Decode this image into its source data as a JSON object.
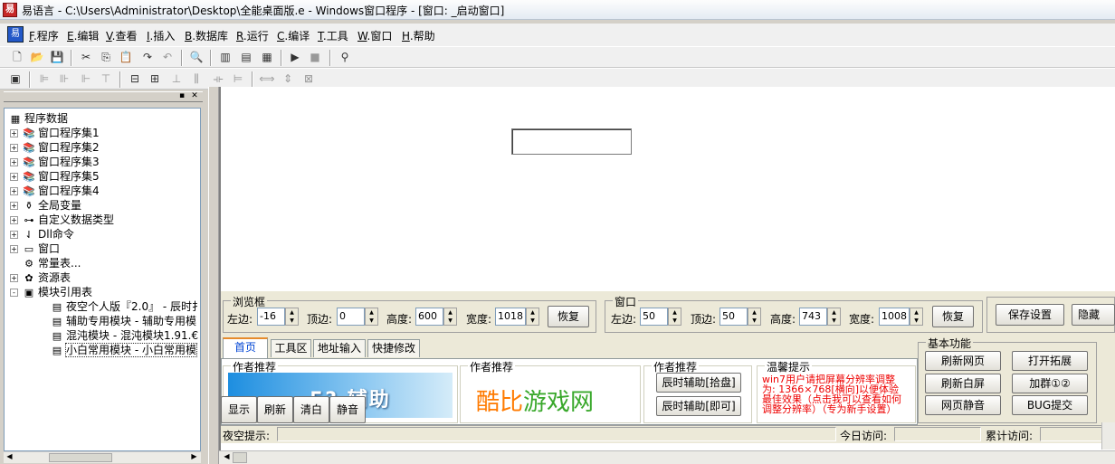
{
  "window": {
    "app_icon": "易",
    "title": "易语言 - C:\\Users\\Administrator\\Desktop\\全能桌面版.e - Windows窗口程序 - [窗口: _启动窗口]"
  },
  "menu": [
    {
      "key": "F",
      "label": ".程序"
    },
    {
      "key": "E",
      "label": ".编辑"
    },
    {
      "key": "V",
      "label": ".查看"
    },
    {
      "key": "I",
      "label": ".插入"
    },
    {
      "key": "B",
      "label": ".数据库"
    },
    {
      "key": "R",
      "label": ".运行"
    },
    {
      "key": "C",
      "label": ".编译"
    },
    {
      "key": "T",
      "label": ".工具"
    },
    {
      "key": "W",
      "label": ".窗口"
    },
    {
      "key": "H",
      "label": ".帮助"
    }
  ],
  "toolbar1_icons": [
    "new-file-icon",
    "open-folder-icon",
    "save-icon",
    "cut-icon",
    "copy-icon",
    "paste-icon",
    "redo-icon",
    "undo-icon",
    "find-icon",
    "layout1-icon",
    "layout2-icon",
    "layout3-icon",
    "run-icon",
    "stop-icon",
    "binoculars-icon"
  ],
  "toolbar2_icons": [
    "grid-icon",
    "align-left-icon",
    "align-center-icon",
    "align-right-icon",
    "align-top-icon",
    "align-middle-icon",
    "align-bottom-icon",
    "space-h-icon",
    "space-v-icon",
    "same-width-icon",
    "same-height-icon",
    "same-size-icon"
  ],
  "tree": {
    "root": "程序数据",
    "items": [
      {
        "label": "窗口程序集1",
        "pm": "+",
        "icon": "books-icon"
      },
      {
        "label": "窗口程序集2",
        "pm": "+",
        "icon": "books-icon"
      },
      {
        "label": "窗口程序集3",
        "pm": "+",
        "icon": "books-icon"
      },
      {
        "label": "窗口程序集5",
        "pm": "+",
        "icon": "books-icon"
      },
      {
        "label": "窗口程序集4",
        "pm": "+",
        "icon": "books-icon"
      },
      {
        "label": "全局变量",
        "pm": "+",
        "icon": "jar-icon"
      },
      {
        "label": "自定义数据类型",
        "pm": "+",
        "icon": "type-icon"
      },
      {
        "label": "Dll命令",
        "pm": "+",
        "icon": "dll-icon"
      },
      {
        "label": "窗口",
        "pm": "+",
        "icon": "window-icon"
      },
      {
        "label": "常量表...",
        "pm": "",
        "icon": "const-icon"
      },
      {
        "label": "资源表",
        "pm": "+",
        "icon": "resource-icon"
      },
      {
        "label": "模块引用表",
        "pm": "-",
        "icon": "module-icon"
      }
    ],
    "modules": [
      "夜空个人版『2.0』 - 辰时扌",
      "辅助专用模块 - 辅助专用模",
      "混沌模块 - 混沌模块1.91.€",
      "小白常用模块 - 小白常用模"
    ]
  },
  "browser_group": {
    "title": "浏览框",
    "left_label": "左边:",
    "left_value": "-16",
    "top_label": "顶边:",
    "top_value": "0",
    "height_label": "高度:",
    "height_value": "600",
    "width_label": "宽度:",
    "width_value": "1018",
    "restore": "恢复"
  },
  "window_group": {
    "title": "窗口",
    "left_label": "左边:",
    "left_value": "50",
    "top_label": "顶边:",
    "top_value": "50",
    "height_label": "高度:",
    "height_value": "743",
    "width_label": "宽度:",
    "width_value": "1008",
    "restore": "恢复"
  },
  "save_settings": "保存设置",
  "hide_label": "隐藏",
  "tabs": [
    "首页",
    "工具区",
    "地址输入",
    "快捷修改"
  ],
  "recommend1": {
    "title": "作者推荐",
    "banner_text": "5?   辅助"
  },
  "recommend2": {
    "title": "作者推荐",
    "kubi_a": "酷比",
    "kubi_b": "游戏网"
  },
  "recommend3": {
    "title": "作者推荐",
    "btn1": "辰时辅助[拾盘]",
    "btn2": "辰时辅助[即可]"
  },
  "warm_tip": {
    "title": "温馨提示",
    "lines": [
      "win7用户请把屏幕分辨率调整",
      "为: 1366×768[横向]以便体验",
      "最佳效果（点击我可以查看如何",
      "调整分辨率）（专为新手设置）"
    ]
  },
  "basic": {
    "title": "基本功能",
    "btn_refresh_web": "刷新网页",
    "btn_open_ext": "打开拓展",
    "btn_refresh_white": "刷新白屏",
    "btn_join": "加群①②",
    "btn_mute": "网页静音",
    "btn_bug": "BUG提交"
  },
  "bottom_btns": [
    "显示",
    "刷新",
    "清白",
    "静音"
  ],
  "status": {
    "night_tip": "夜空提示:",
    "today_visits": "今日访问:",
    "total_visits": "累计访问:"
  },
  "colors": {
    "tip_red": "#e00000",
    "kubi_orange": "#ff7a00",
    "kubi_green": "#39a82b"
  }
}
